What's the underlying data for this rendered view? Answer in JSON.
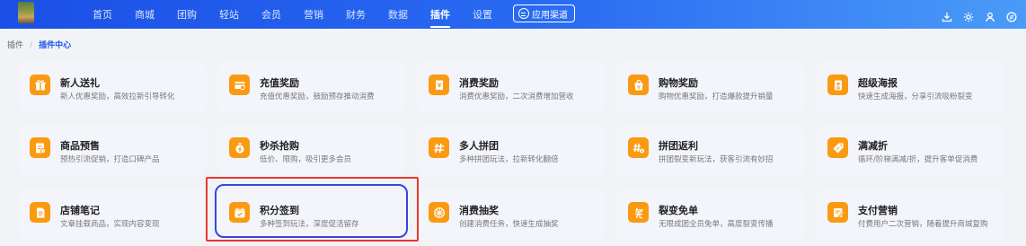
{
  "nav": {
    "items": [
      "首页",
      "商城",
      "团购",
      "轻站",
      "会员",
      "营销",
      "财务",
      "数据",
      "插件",
      "设置"
    ],
    "active": "插件",
    "app_channel_label": "应用渠道"
  },
  "breadcrumb": {
    "parent": "插件",
    "separator": "/",
    "current": "插件中心"
  },
  "accent_color": "#fa9a12",
  "nav_color": "#2a6cf2",
  "cards": [
    {
      "title": "新人送礼",
      "desc": "新人优惠奖励，高效拉新引导转化",
      "icon": "gift-icon"
    },
    {
      "title": "充值奖励",
      "desc": "充值优惠奖励，鼓励预存推动消费",
      "icon": "card-recharge-icon"
    },
    {
      "title": "消费奖励",
      "desc": "消费优惠奖励，二次消费增加营收",
      "icon": "receipt-icon"
    },
    {
      "title": "购物奖励",
      "desc": "购物优惠奖励，打造爆款提升销量",
      "icon": "shopping-bag-icon"
    },
    {
      "title": "超级海报",
      "desc": "快速生成海报，分享引流吸粉裂变",
      "icon": "poster-icon"
    },
    {
      "title": "商品预售",
      "desc": "预热引流促销，打造口碑产品",
      "icon": "presale-icon"
    },
    {
      "title": "秒杀抢购",
      "desc": "低价、限购，吸引更多会员",
      "icon": "stopwatch-icon"
    },
    {
      "title": "多人拼团",
      "desc": "多种拼团玩法，拉新转化翻倍",
      "icon": "group-buy-icon"
    },
    {
      "title": "拼团返利",
      "desc": "拼团裂变新玩法，获客引流有妙招",
      "icon": "group-rebate-icon"
    },
    {
      "title": "满减折",
      "desc": "循环/阶梯满减/折，提升客单促消费",
      "icon": "discount-tag-icon"
    },
    {
      "title": "店铺笔记",
      "desc": "文章挂载商品，实现内容变现",
      "icon": "notebook-icon"
    },
    {
      "title": "积分签到",
      "desc": "多种签到玩法，深度促活留存",
      "icon": "calendar-check-icon"
    },
    {
      "title": "消费抽奖",
      "desc": "创建消费任务，快速生成抽奖",
      "icon": "lottery-wheel-icon"
    },
    {
      "title": "裂变免单",
      "desc": "无限成团全员免单，高度裂变传播",
      "icon": "free-order-icon"
    },
    {
      "title": "支付营销",
      "desc": "付费用户二次营销，随着提升商城复购",
      "icon": "payment-icon"
    }
  ]
}
